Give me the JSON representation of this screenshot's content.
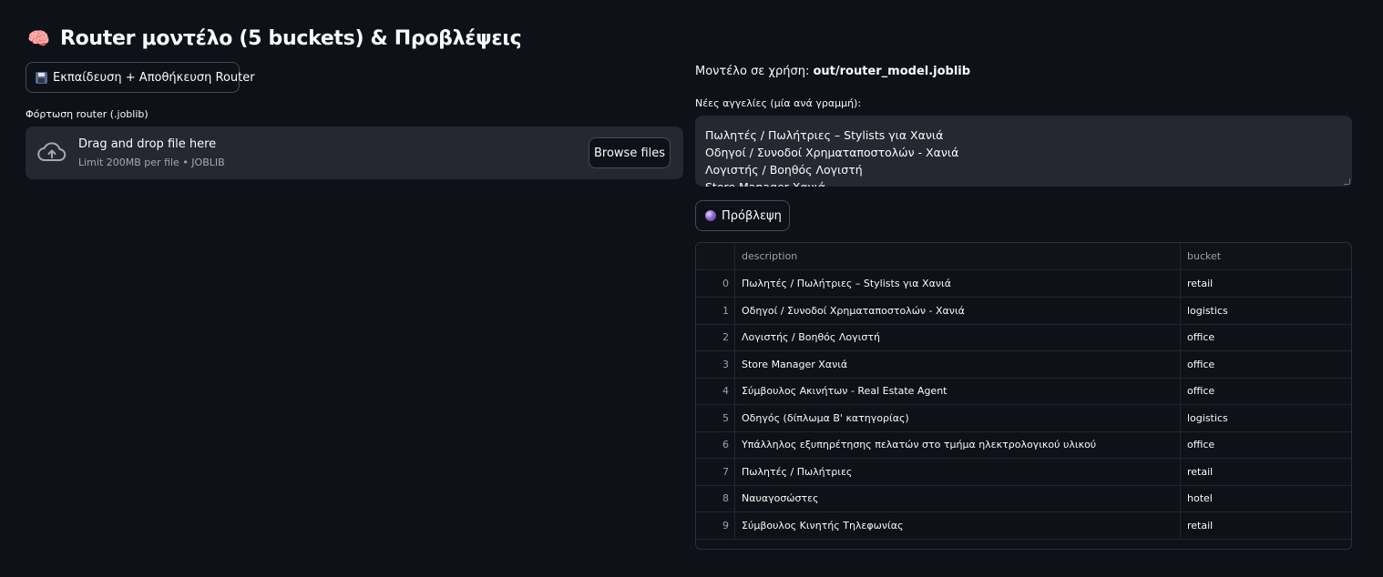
{
  "header": {
    "icon": "brain-icon",
    "title": "Router μοντέλο (5 buckets) & Προβλέψεις"
  },
  "left": {
    "train_button_label": "Εκπαίδευση + Αποθήκευση Router",
    "uploader": {
      "label": "Φόρτωση router (.joblib)",
      "drop_text": "Drag and drop file here",
      "limit_text": "Limit 200MB per file • JOBLIB",
      "browse_label": "Browse files"
    }
  },
  "right": {
    "model_label": "Μοντέλο σε χρήση:",
    "model_path": "out/router_model.joblib",
    "textarea_label": "Νέες αγγελίες (μία ανά γραμμή):",
    "textarea_lines": [
      "Πωλητές / Πωλήτριες – Stylists για Χανιά",
      "Οδηγοί / Συνοδοί Χρηματαποστολών - Χανιά",
      "Λογιστής / Βοηθός Λογιστή",
      "Store Manager Χανιά"
    ],
    "predict_button_label": "Πρόβλεψη"
  },
  "table": {
    "columns": [
      "",
      "description",
      "bucket"
    ],
    "rows": [
      {
        "index": "0",
        "description": "Πωλητές / Πωλήτριες – Stylists για Χανιά",
        "bucket": "retail"
      },
      {
        "index": "1",
        "description": "Οδηγοί / Συνοδοί Χρηματαποστολών - Χανιά",
        "bucket": "logistics"
      },
      {
        "index": "2",
        "description": "Λογιστής / Βοηθός Λογιστή",
        "bucket": "office"
      },
      {
        "index": "3",
        "description": "Store Manager Χανιά",
        "bucket": "office"
      },
      {
        "index": "4",
        "description": "Σύμβουλος Ακινήτων - Real Estate Agent",
        "bucket": "office"
      },
      {
        "index": "5",
        "description": "Οδηγός (δίπλωμα Β' κατηγορίας)",
        "bucket": "logistics"
      },
      {
        "index": "6",
        "description": "Υπάλληλος εξυπηρέτησης πελατών στο τμήμα ηλεκτρολογικού υλικού",
        "bucket": "office"
      },
      {
        "index": "7",
        "description": "Πωλητές / Πωλήτριες",
        "bucket": "retail"
      },
      {
        "index": "8",
        "description": "Ναυαγοσώστες",
        "bucket": "hotel"
      },
      {
        "index": "9",
        "description": "Σύμβουλος Κινητής Τηλεφωνίας",
        "bucket": "retail"
      }
    ]
  }
}
